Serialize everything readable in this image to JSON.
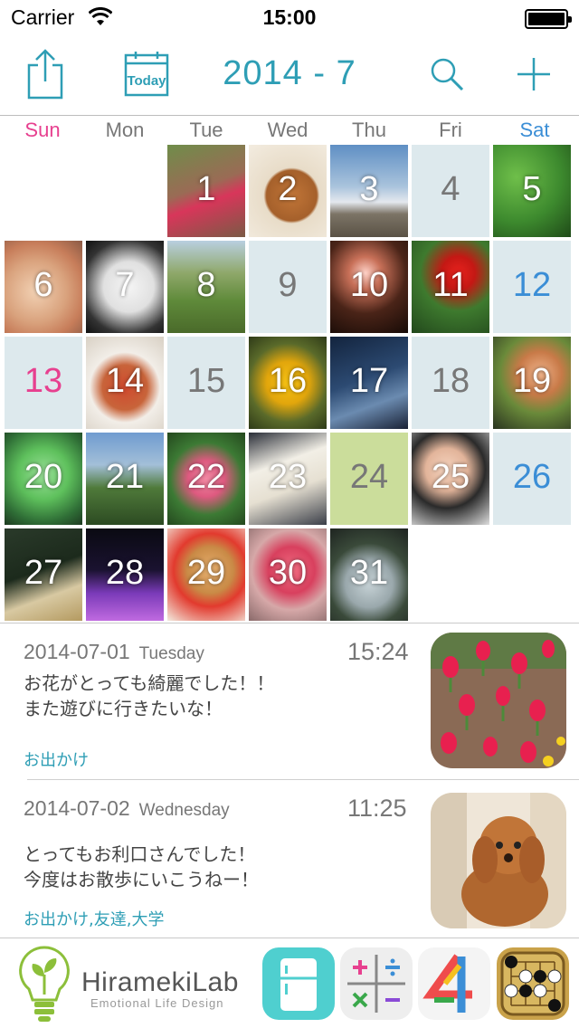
{
  "status": {
    "carrier": "Carrier",
    "time": "15:00"
  },
  "nav": {
    "title": "2014 - 7",
    "today_label": "Today"
  },
  "weekdays": [
    "Sun",
    "Mon",
    "Tue",
    "Wed",
    "Thu",
    "Fri",
    "Sat"
  ],
  "colors": {
    "accent": "#2e9eb5",
    "sunday": "#e7408f",
    "saturday": "#3b8ed6",
    "plain_cell": "#dde9ed",
    "today_cell": "#cbdd9b"
  },
  "calendar": {
    "days": [
      {
        "day": "1",
        "photo": true,
        "theme": "tulips"
      },
      {
        "day": "2",
        "photo": true,
        "theme": "poodle"
      },
      {
        "day": "3",
        "photo": true,
        "theme": "sky"
      },
      {
        "day": "4",
        "photo": false
      },
      {
        "day": "5",
        "photo": true,
        "theme": "trees"
      },
      {
        "day": "6",
        "photo": true,
        "theme": "bread"
      },
      {
        "day": "7",
        "photo": true,
        "theme": "swans"
      },
      {
        "day": "8",
        "photo": true,
        "theme": "field"
      },
      {
        "day": "9",
        "photo": false
      },
      {
        "day": "10",
        "photo": true,
        "theme": "candles"
      },
      {
        "day": "11",
        "photo": true,
        "theme": "redflower"
      },
      {
        "day": "12",
        "photo": false
      },
      {
        "day": "13",
        "photo": false
      },
      {
        "day": "14",
        "photo": true,
        "theme": "pasta"
      },
      {
        "day": "15",
        "photo": false
      },
      {
        "day": "16",
        "photo": true,
        "theme": "yellowflower"
      },
      {
        "day": "17",
        "photo": true,
        "theme": "dusk"
      },
      {
        "day": "18",
        "photo": false
      },
      {
        "day": "19",
        "photo": true,
        "theme": "plates"
      },
      {
        "day": "20",
        "photo": true,
        "theme": "icecream"
      },
      {
        "day": "21",
        "photo": true,
        "theme": "mountains"
      },
      {
        "day": "22",
        "photo": true,
        "theme": "camellia"
      },
      {
        "day": "23",
        "photo": true,
        "theme": "sewing"
      },
      {
        "day": "24",
        "photo": false,
        "today": true
      },
      {
        "day": "25",
        "photo": true,
        "theme": "camera"
      },
      {
        "day": "26",
        "photo": false
      },
      {
        "day": "27",
        "photo": true,
        "theme": "champagne"
      },
      {
        "day": "28",
        "photo": true,
        "theme": "tower"
      },
      {
        "day": "29",
        "photo": true,
        "theme": "sandwich"
      },
      {
        "day": "30",
        "photo": true,
        "theme": "rose"
      },
      {
        "day": "31",
        "photo": true,
        "theme": "jar"
      }
    ]
  },
  "entries": [
    {
      "date": "2014-07-01",
      "weekday": "Tuesday",
      "time": "15:24",
      "line1": "お花がとっても綺麗でした！！",
      "line2": "また遊びに行きたいな！",
      "tags": "お出かけ",
      "photo": "tulips"
    },
    {
      "date": "2014-07-02",
      "weekday": "Wednesday",
      "time": "11:25",
      "line1": "とってもお利口さんでした！",
      "line2": "今度はお散歩にいこうねー！",
      "tags": "お出かけ,友達,大学",
      "photo": "poodle"
    }
  ],
  "footer": {
    "brand": "HiramekiLab",
    "tagline": "Emotional Life Design",
    "apps": [
      "fridge-app-icon",
      "calculator-app-icon",
      "four-app-icon",
      "go-game-app-icon"
    ],
    "app_digit": "4"
  }
}
